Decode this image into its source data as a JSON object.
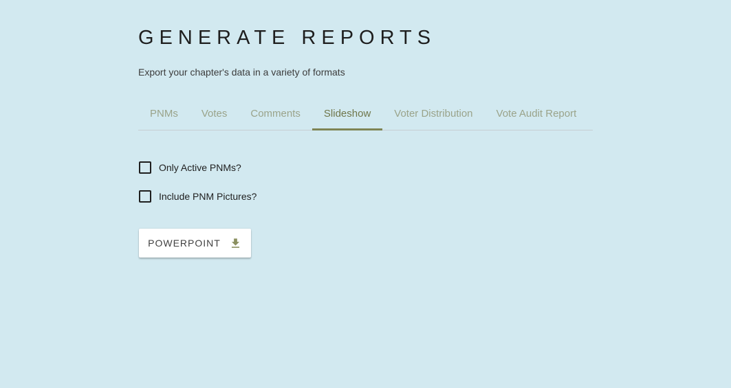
{
  "page": {
    "title": "GENERATE REPORTS",
    "subtitle": "Export your chapter's data in a variety of formats"
  },
  "tabs": {
    "items": [
      {
        "label": "PNMs",
        "active": false
      },
      {
        "label": "Votes",
        "active": false
      },
      {
        "label": "Comments",
        "active": false
      },
      {
        "label": "Slideshow",
        "active": true
      },
      {
        "label": "Voter Distribution",
        "active": false
      },
      {
        "label": "Vote Audit Report",
        "active": false
      }
    ],
    "active_tab": "Slideshow"
  },
  "options": {
    "only_active_pnms": {
      "label": "Only Active PNMs?",
      "checked": false
    },
    "include_pnm_pictures": {
      "label": "Include PNM Pictures?",
      "checked": false
    }
  },
  "export": {
    "powerpoint_label": "POWERPOINT",
    "icon": "download-icon"
  },
  "colors": {
    "background": "#d2e9f0",
    "accent_olive": "#7e8454",
    "tab_inactive_text": "#9aa38a",
    "tab_active_text": "#6f764a",
    "divider": "#c6ced2",
    "text_dark": "#1e1e1e",
    "button_background": "#ffffff",
    "download_icon": "#8b9060"
  }
}
